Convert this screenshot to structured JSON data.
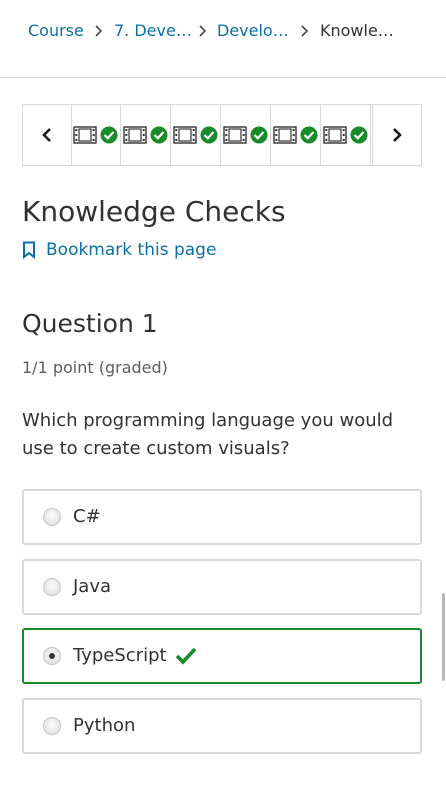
{
  "breadcrumb": {
    "items": [
      {
        "label": "Course"
      },
      {
        "label": "7. Deve…"
      },
      {
        "label": "Develo…"
      },
      {
        "label": "Knowle…"
      }
    ]
  },
  "sequence": {
    "units": [
      {
        "icon": "video-icon",
        "status": "complete"
      },
      {
        "icon": "video-icon",
        "status": "complete"
      },
      {
        "icon": "video-icon",
        "status": "complete"
      },
      {
        "icon": "video-icon",
        "status": "complete"
      },
      {
        "icon": "video-icon",
        "status": "complete"
      },
      {
        "icon": "video-icon",
        "status": "complete"
      }
    ]
  },
  "page": {
    "title": "Knowledge Checks",
    "bookmark_label": "Bookmark this page"
  },
  "question": {
    "title": "Question 1",
    "points": "1/1 point (graded)",
    "prompt": "Which programming language you would use to create custom visuals?",
    "options": [
      {
        "label": "C#",
        "selected": false
      },
      {
        "label": "Java",
        "selected": false
      },
      {
        "label": "TypeScript",
        "selected": true,
        "correct": true
      },
      {
        "label": "Python",
        "selected": false
      }
    ]
  },
  "colors": {
    "link": "#0b6fa4",
    "success": "#178a2a",
    "border": "#d9d9d9",
    "text": "#313131"
  }
}
